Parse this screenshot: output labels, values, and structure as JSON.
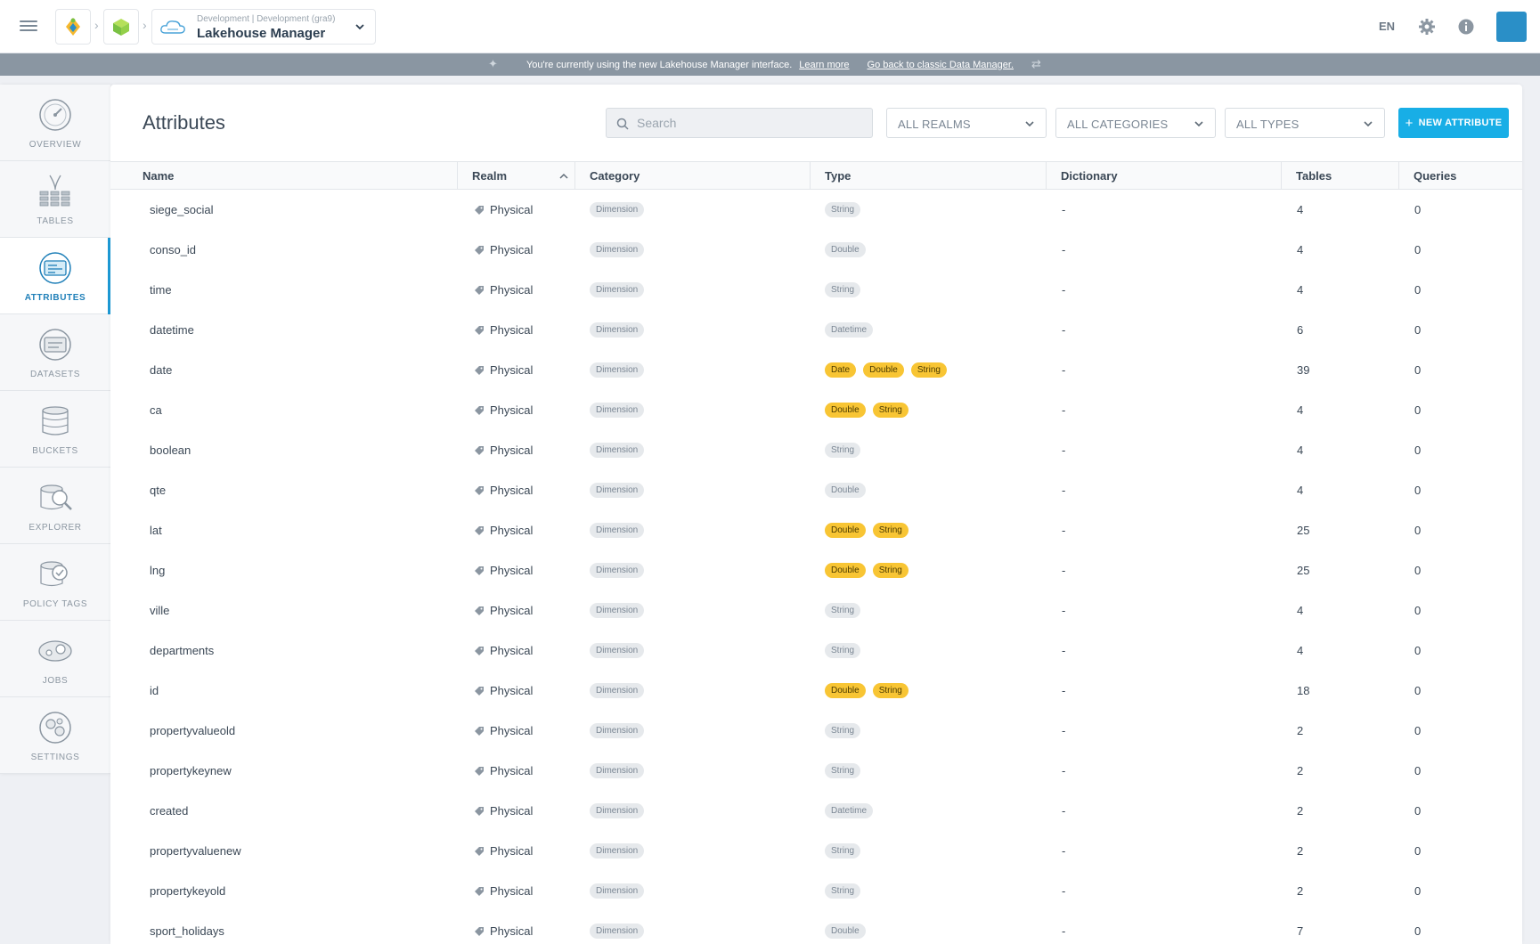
{
  "topbar": {
    "env_label": "Development | Development (gra9)",
    "app_name": "Lakehouse Manager",
    "lang": "EN"
  },
  "banner": {
    "text": "You're currently using the new Lakehouse Manager interface.",
    "learn_more": "Learn more",
    "classic_link": "Go back to classic Data Manager."
  },
  "sidebar": {
    "items": [
      {
        "label": "OVERVIEW",
        "icon": "overview-icon"
      },
      {
        "label": "TABLES",
        "icon": "tables-icon"
      },
      {
        "label": "ATTRIBUTES",
        "icon": "attributes-icon"
      },
      {
        "label": "DATASETS",
        "icon": "datasets-icon"
      },
      {
        "label": "BUCKETS",
        "icon": "buckets-icon"
      },
      {
        "label": "EXPLORER",
        "icon": "explorer-icon"
      },
      {
        "label": "POLICY TAGS",
        "icon": "policy-tags-icon"
      },
      {
        "label": "JOBS",
        "icon": "jobs-icon"
      },
      {
        "label": "SETTINGS",
        "icon": "settings-icon"
      }
    ],
    "active": "ATTRIBUTES"
  },
  "main": {
    "title": "Attributes",
    "search_placeholder": "Search",
    "filters": {
      "realms": "ALL REALMS",
      "categories": "ALL CATEGORIES",
      "types": "ALL TYPES"
    },
    "new_button": "NEW ATTRIBUTE"
  },
  "table": {
    "columns": [
      "Name",
      "Realm",
      "Category",
      "Type",
      "Dictionary",
      "Tables",
      "Queries"
    ],
    "rows": [
      {
        "name": "siege_social",
        "realm": "Physical",
        "category": "Dimension",
        "types": [
          "String"
        ],
        "multi": false,
        "dictionary": "-",
        "tables": "4",
        "queries": "0"
      },
      {
        "name": "conso_id",
        "realm": "Physical",
        "category": "Dimension",
        "types": [
          "Double"
        ],
        "multi": false,
        "dictionary": "-",
        "tables": "4",
        "queries": "0"
      },
      {
        "name": "time",
        "realm": "Physical",
        "category": "Dimension",
        "types": [
          "String"
        ],
        "multi": false,
        "dictionary": "-",
        "tables": "4",
        "queries": "0"
      },
      {
        "name": "datetime",
        "realm": "Physical",
        "category": "Dimension",
        "types": [
          "Datetime"
        ],
        "multi": false,
        "dictionary": "-",
        "tables": "6",
        "queries": "0"
      },
      {
        "name": "date",
        "realm": "Physical",
        "category": "Dimension",
        "types": [
          "Date",
          "Double",
          "String"
        ],
        "multi": true,
        "dictionary": "-",
        "tables": "39",
        "queries": "0"
      },
      {
        "name": "ca",
        "realm": "Physical",
        "category": "Dimension",
        "types": [
          "Double",
          "String"
        ],
        "multi": true,
        "dictionary": "-",
        "tables": "4",
        "queries": "0"
      },
      {
        "name": "boolean",
        "realm": "Physical",
        "category": "Dimension",
        "types": [
          "String"
        ],
        "multi": false,
        "dictionary": "-",
        "tables": "4",
        "queries": "0"
      },
      {
        "name": "qte",
        "realm": "Physical",
        "category": "Dimension",
        "types": [
          "Double"
        ],
        "multi": false,
        "dictionary": "-",
        "tables": "4",
        "queries": "0"
      },
      {
        "name": "lat",
        "realm": "Physical",
        "category": "Dimension",
        "types": [
          "Double",
          "String"
        ],
        "multi": true,
        "dictionary": "-",
        "tables": "25",
        "queries": "0"
      },
      {
        "name": "lng",
        "realm": "Physical",
        "category": "Dimension",
        "types": [
          "Double",
          "String"
        ],
        "multi": true,
        "dictionary": "-",
        "tables": "25",
        "queries": "0"
      },
      {
        "name": "ville",
        "realm": "Physical",
        "category": "Dimension",
        "types": [
          "String"
        ],
        "multi": false,
        "dictionary": "-",
        "tables": "4",
        "queries": "0"
      },
      {
        "name": "departments",
        "realm": "Physical",
        "category": "Dimension",
        "types": [
          "String"
        ],
        "multi": false,
        "dictionary": "-",
        "tables": "4",
        "queries": "0"
      },
      {
        "name": "id",
        "realm": "Physical",
        "category": "Dimension",
        "types": [
          "Double",
          "String"
        ],
        "multi": true,
        "dictionary": "-",
        "tables": "18",
        "queries": "0"
      },
      {
        "name": "propertyvalueold",
        "realm": "Physical",
        "category": "Dimension",
        "types": [
          "String"
        ],
        "multi": false,
        "dictionary": "-",
        "tables": "2",
        "queries": "0"
      },
      {
        "name": "propertykeynew",
        "realm": "Physical",
        "category": "Dimension",
        "types": [
          "String"
        ],
        "multi": false,
        "dictionary": "-",
        "tables": "2",
        "queries": "0"
      },
      {
        "name": "created",
        "realm": "Physical",
        "category": "Dimension",
        "types": [
          "Datetime"
        ],
        "multi": false,
        "dictionary": "-",
        "tables": "2",
        "queries": "0"
      },
      {
        "name": "propertyvaluenew",
        "realm": "Physical",
        "category": "Dimension",
        "types": [
          "String"
        ],
        "multi": false,
        "dictionary": "-",
        "tables": "2",
        "queries": "0"
      },
      {
        "name": "propertykeyold",
        "realm": "Physical",
        "category": "Dimension",
        "types": [
          "String"
        ],
        "multi": false,
        "dictionary": "-",
        "tables": "2",
        "queries": "0"
      },
      {
        "name": "sport_holidays",
        "realm": "Physical",
        "category": "Dimension",
        "types": [
          "Double"
        ],
        "multi": false,
        "dictionary": "-",
        "tables": "7",
        "queries": "0"
      }
    ]
  },
  "colors": {
    "accent": "#18aee6",
    "active_nav": "#1e7fb8",
    "multi_type_pill": "#f8c534",
    "banner": "#8a96a2"
  }
}
